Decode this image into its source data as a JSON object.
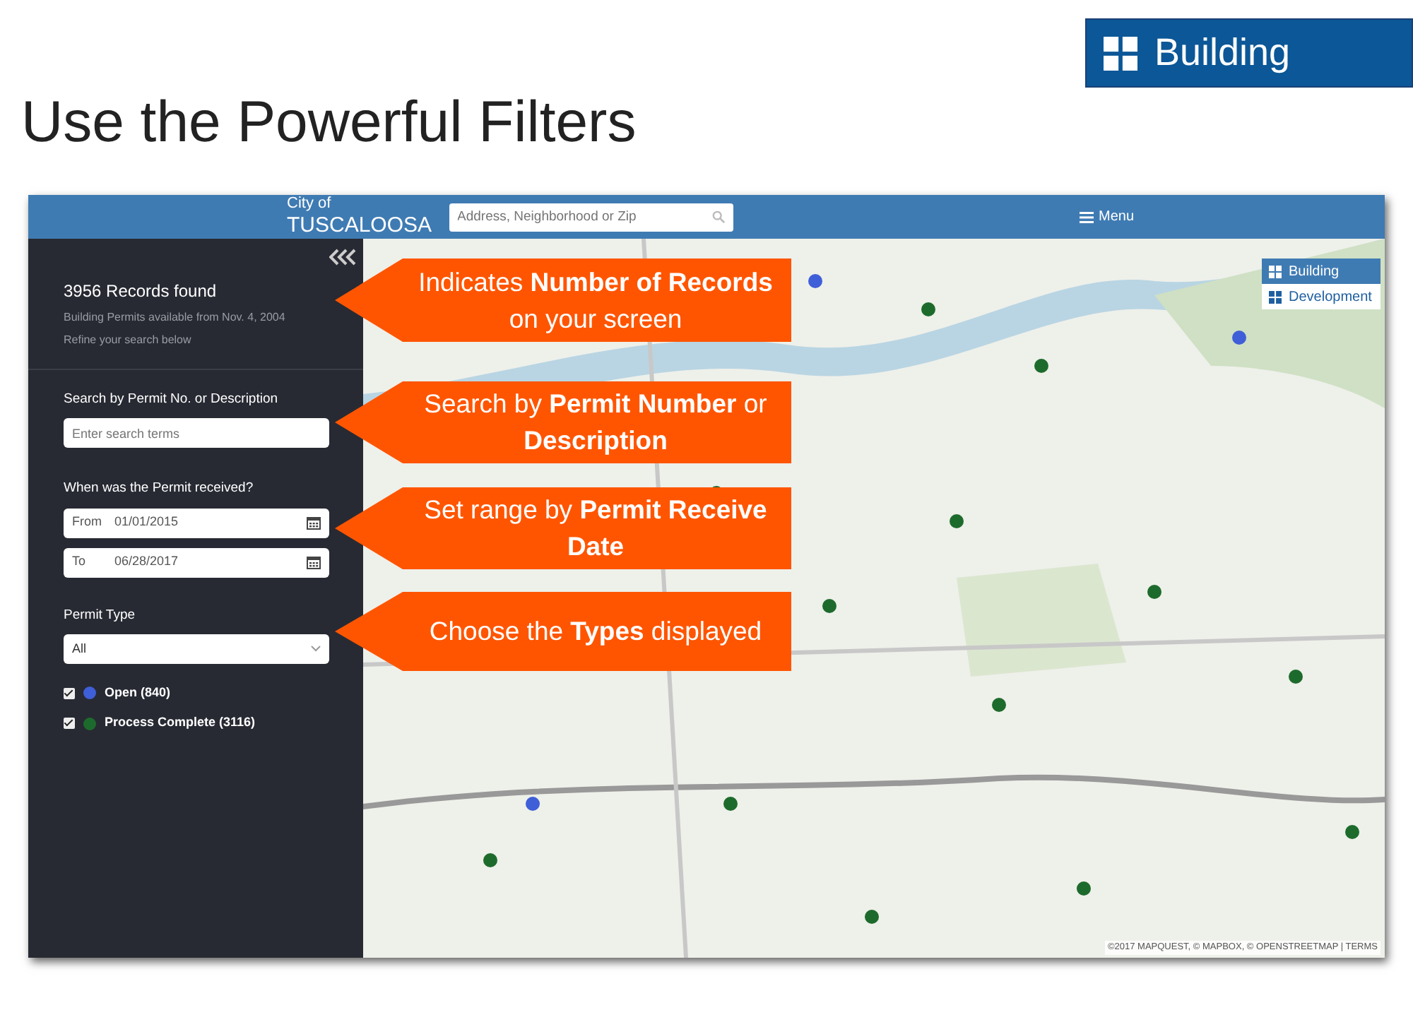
{
  "slide": {
    "badge": "Building",
    "title": "Use the Powerful Filters"
  },
  "header": {
    "logo_small": "City of",
    "logo_large": "TUSCALOOSA",
    "search": {
      "placeholder": "Address, Neighborhood or Zip"
    },
    "menu": "Menu"
  },
  "sidebar": {
    "records": "3956 Records found",
    "availability": "Building Permits available from Nov. 4, 2004",
    "hint": "Refine your search below",
    "search_label": "Search by Permit No. or Description",
    "search": {
      "placeholder": "Enter search terms"
    },
    "date_label": "When was the Permit received?",
    "dates": [
      {
        "label": "From",
        "value": "01/01/2015"
      },
      {
        "label": "To",
        "value": "06/28/2017"
      }
    ],
    "type_label": "Permit Type",
    "type_value": "All",
    "statuses": [
      {
        "label": "Open",
        "count": "(840)",
        "checked": true,
        "color": "#3f5fd8"
      },
      {
        "label": "Process Complete",
        "count": "(3116)",
        "checked": true,
        "color": "#1d6b2c"
      }
    ]
  },
  "map": {
    "kind": "picture",
    "layers": [
      {
        "label": "Building",
        "selected": true
      },
      {
        "label": "Development",
        "selected": false
      }
    ],
    "attribution": "©2017 MAPQUEST, © MAPBOX, © OPENSTREETMAP | TERMS"
  },
  "callouts": [
    {
      "text": "Indicates **Number of Records** on your screen"
    },
    {
      "text": "Search by **Permit Number** or **Description**"
    },
    {
      "text": "Set range by **Permit Receive Date**"
    },
    {
      "text": "Choose the **Types** displayed"
    }
  ]
}
